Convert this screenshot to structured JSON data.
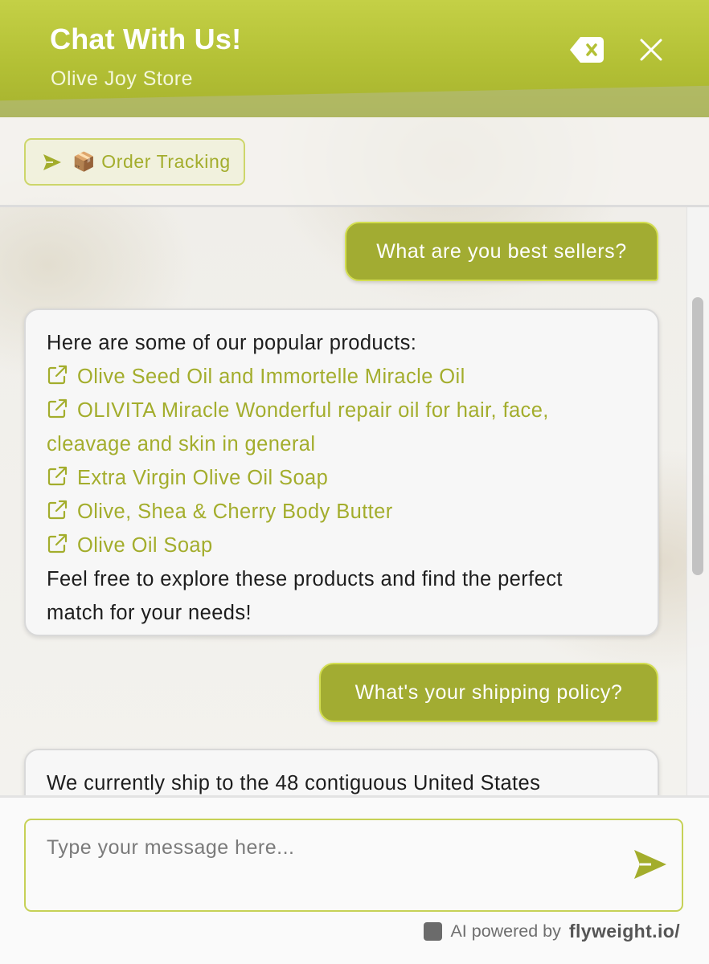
{
  "header": {
    "title": "Chat With Us!",
    "subtitle": "Olive Joy Store",
    "clear_icon": "backspace-icon",
    "close_icon": "close-icon"
  },
  "quick_actions": {
    "order_tracking_label": "📦 Order Tracking"
  },
  "messages": [
    {
      "role": "user",
      "text": "What are you best sellers?"
    },
    {
      "role": "bot",
      "intro": "Here are some of our popular products:",
      "products": [
        "Olive Seed Oil and Immortelle Miracle Oil",
        "OLIVITA Miracle Wonderful repair oil for hair, face,",
        "cleavage and skin in general",
        "Extra Virgin Olive Oil Soap",
        "Olive, Shea & Cherry Body Butter",
        "Olive Oil Soap"
      ],
      "outro_line1": "Feel free to explore these products and find the perfect",
      "outro_line2": "match for your needs!"
    },
    {
      "role": "user",
      "text": "What's your shipping policy?"
    },
    {
      "role": "bot",
      "text": "We currently ship to the 48 contiguous United States"
    }
  ],
  "composer": {
    "placeholder": "Type your message here...",
    "value": ""
  },
  "footer": {
    "powered_by": "AI powered by",
    "brand": "flyweight.io/"
  },
  "colors": {
    "accent": "#a2ac32",
    "header": "#b8c43a",
    "link": "#a3ad2c"
  }
}
